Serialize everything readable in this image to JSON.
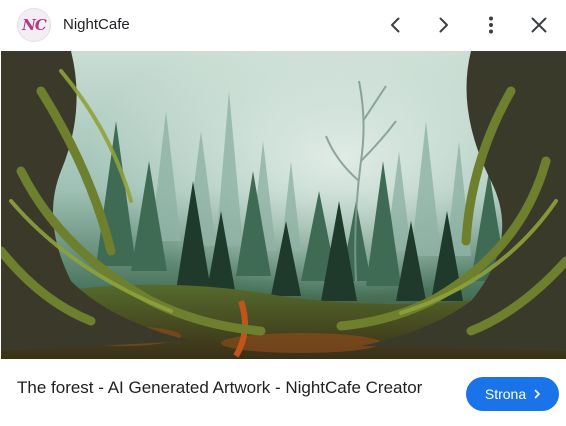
{
  "header": {
    "site_logo": "NC",
    "site_name": "NightCafe",
    "icons": {
      "previous": "chevron-left-icon",
      "next": "chevron-right-icon",
      "more": "more-vert-icon",
      "close": "close-icon"
    }
  },
  "image": {
    "lens_icon": "lens-search-icon"
  },
  "result": {
    "title": "The forest - AI Generated Artwork - NightCafe Creator",
    "visit_label": "Strona",
    "visit_icon": "chevron-right-icon"
  },
  "colors": {
    "accent": "#1a73e8",
    "logo": "#b5378a"
  }
}
